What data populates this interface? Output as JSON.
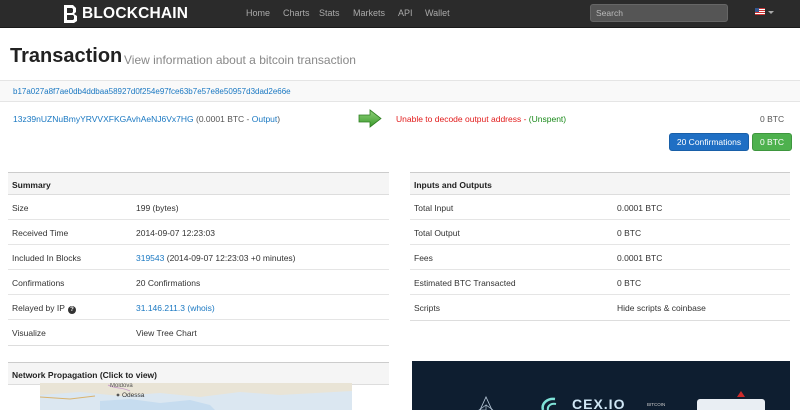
{
  "nav": {
    "brand": "BLOCKCHAIN",
    "links": [
      "Home",
      "Charts",
      "Stats",
      "Markets",
      "API",
      "Wallet"
    ],
    "search_placeholder": "Search",
    "language_flag": "us-flag-icon"
  },
  "header": {
    "title": "Transaction",
    "subtitle": "View information about a bitcoin transaction"
  },
  "tx": {
    "hash": "b17a027a8f7ae0db4ddbaa58927d0f254e97fce63b7e57e8e50957d3dad2e66e",
    "input_address": "13z39nUZNuBmyYRVVXFKGAvhAeNJ6Vx7HG",
    "input_amount": "(0.0001 BTC - ",
    "input_link": "Output",
    "input_close": ")",
    "output_error": "Unable to decode output address",
    "output_sep": " - ",
    "output_status": "(Unspent)",
    "output_amount": "0 BTC",
    "confirmations_button": "20 Confirmations",
    "total_button": "0 BTC"
  },
  "summary": {
    "title": "Summary",
    "size_label": "Size",
    "size_value": "199 (bytes)",
    "received_label": "Received Time",
    "received_value": "2014-09-07 12:23:03",
    "blocks_label": "Included In Blocks",
    "blocks_link": "319543",
    "blocks_rest": " (2014-09-07 12:23:03 +0 minutes)",
    "conf_label": "Confirmations",
    "conf_value": "20 Confirmations",
    "relay_label": "Relayed by IP",
    "relay_ip": "31.146.211.3",
    "relay_whois": " (whois)",
    "visualize_label": "Visualize",
    "visualize_link": "View Tree Chart"
  },
  "io": {
    "title": "Inputs and Outputs",
    "total_input_label": "Total Input",
    "total_input_value": "0.0001 BTC",
    "total_output_label": "Total Output",
    "total_output_value": "0 BTC",
    "fees_label": "Fees",
    "fees_value": "0.0001 BTC",
    "estimated_label": "Estimated BTC Transacted",
    "estimated_value": "0 BTC",
    "scripts_label": "Scripts",
    "scripts_link": "Hide scripts & coinbase"
  },
  "propagation": {
    "title": "Network Propagation (Click to view)",
    "map_label_1": "Moldova",
    "map_label_2": "Odessa"
  },
  "ad": {
    "brand": "CEX.IO",
    "tag": "BITCOIN"
  },
  "colors": {
    "navbar": "#2b2b2b",
    "link": "#1a78c2",
    "error": "#e21b1b",
    "unspent": "#1a8a1a",
    "confirm_button": "#1f6fc4",
    "btc_button": "#4eb14e"
  }
}
